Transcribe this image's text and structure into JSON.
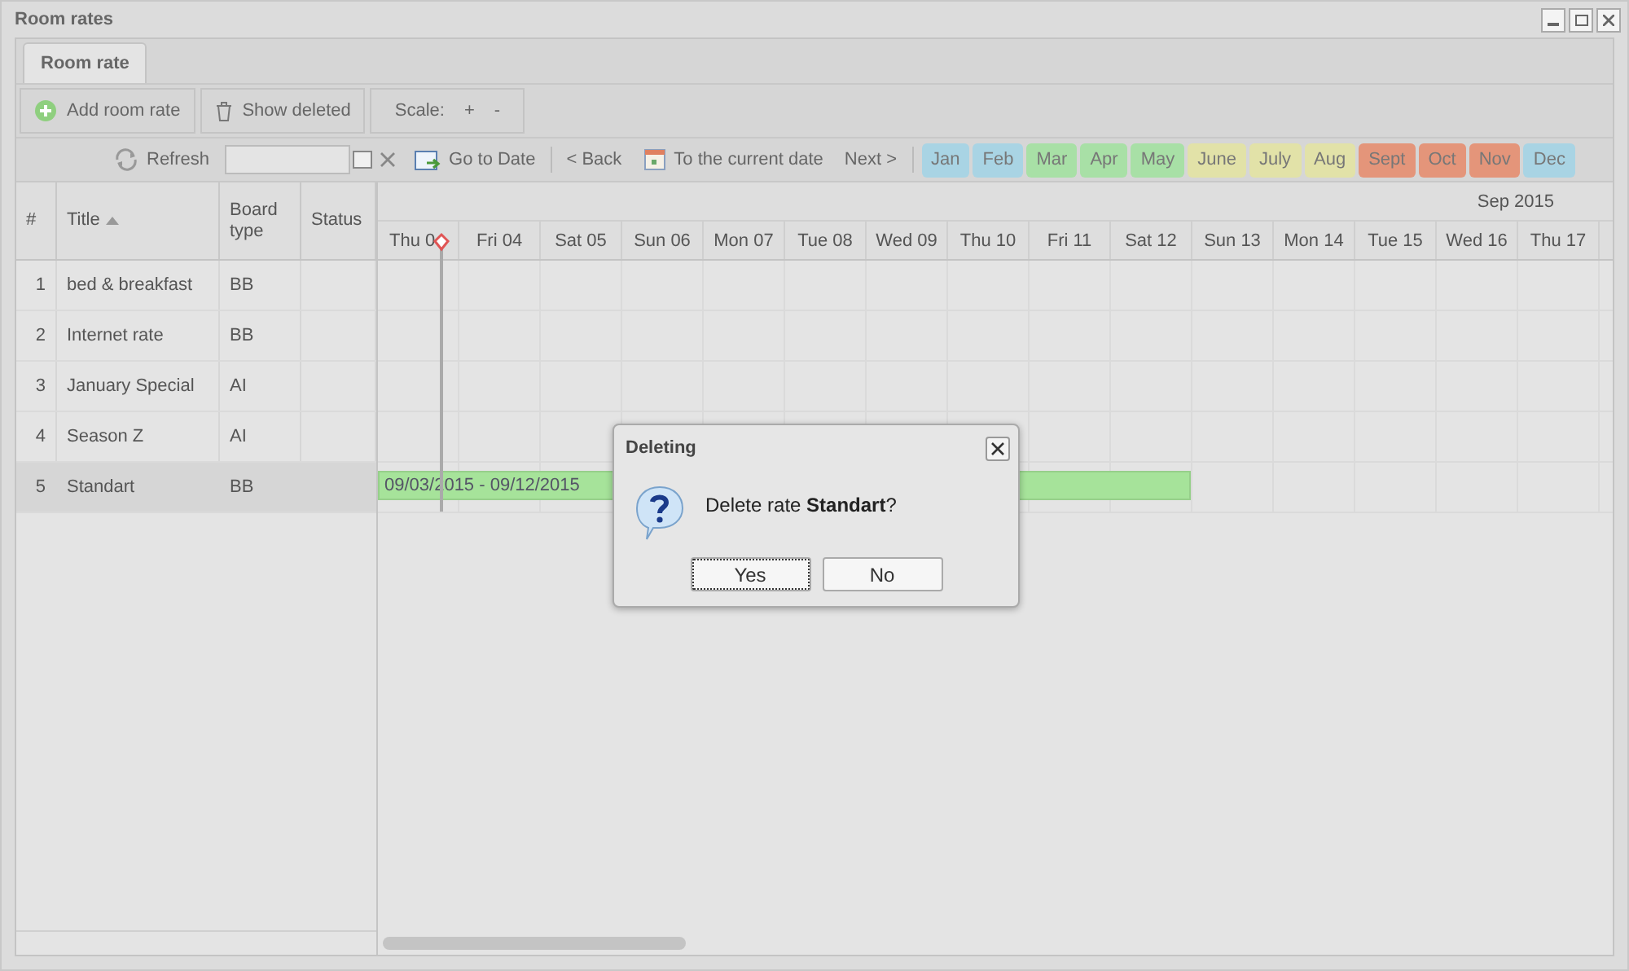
{
  "window": {
    "title": "Room rates"
  },
  "tabs": [
    {
      "label": "Room rate",
      "selected": true
    }
  ],
  "toolbar": {
    "add": "Add room rate",
    "show_deleted": "Show deleted",
    "scale_label": "Scale:",
    "scale_plus": "+",
    "scale_minus": "-"
  },
  "nav": {
    "refresh": "Refresh",
    "go_to_date": "Go to Date",
    "back": "< Back",
    "current": "To the current date",
    "next": "Next >"
  },
  "months": [
    {
      "label": "Jan",
      "color": "#a9d4e4"
    },
    {
      "label": "Feb",
      "color": "#a9d4e4"
    },
    {
      "label": "Mar",
      "color": "#a8e0a6"
    },
    {
      "label": "Apr",
      "color": "#a8e0a6"
    },
    {
      "label": "May",
      "color": "#a8e0a6"
    },
    {
      "label": "June",
      "color": "#e2e2a8"
    },
    {
      "label": "July",
      "color": "#e2e2a8"
    },
    {
      "label": "Aug",
      "color": "#e2e2a8"
    },
    {
      "label": "Sept",
      "color": "#e4957a"
    },
    {
      "label": "Oct",
      "color": "#e4957a"
    },
    {
      "label": "Nov",
      "color": "#e4957a"
    },
    {
      "label": "Dec",
      "color": "#a9d4e4"
    }
  ],
  "grid": {
    "columns": [
      "#",
      "Title",
      "Board type",
      "Status"
    ],
    "rows": [
      {
        "num": "1",
        "title": "bed & breakfast",
        "board": "BB",
        "selected": false
      },
      {
        "num": "2",
        "title": "Internet rate",
        "board": "BB",
        "selected": false
      },
      {
        "num": "3",
        "title": "January Special",
        "board": "AI",
        "selected": false
      },
      {
        "num": "4",
        "title": "Season Z",
        "board": "AI",
        "selected": false
      },
      {
        "num": "5",
        "title": "Standart",
        "board": "BB",
        "selected": true,
        "bar": "09/03/2015 - 09/12/2015"
      }
    ]
  },
  "timeline": {
    "month": "Sep 2015",
    "days": [
      "Thu 0",
      "Fri 04",
      "Sat 05",
      "Sun 06",
      "Mon 07",
      "Tue 08",
      "Wed 09",
      "Thu 10",
      "Fri 11",
      "Sat 12",
      "Sun 13",
      "Mon 14",
      "Tue 15",
      "Wed 16",
      "Thu 17"
    ]
  },
  "dialog": {
    "title": "Deleting",
    "message": "Delete rate **Standart**?",
    "buttons": [
      "Yes",
      "No"
    ]
  }
}
